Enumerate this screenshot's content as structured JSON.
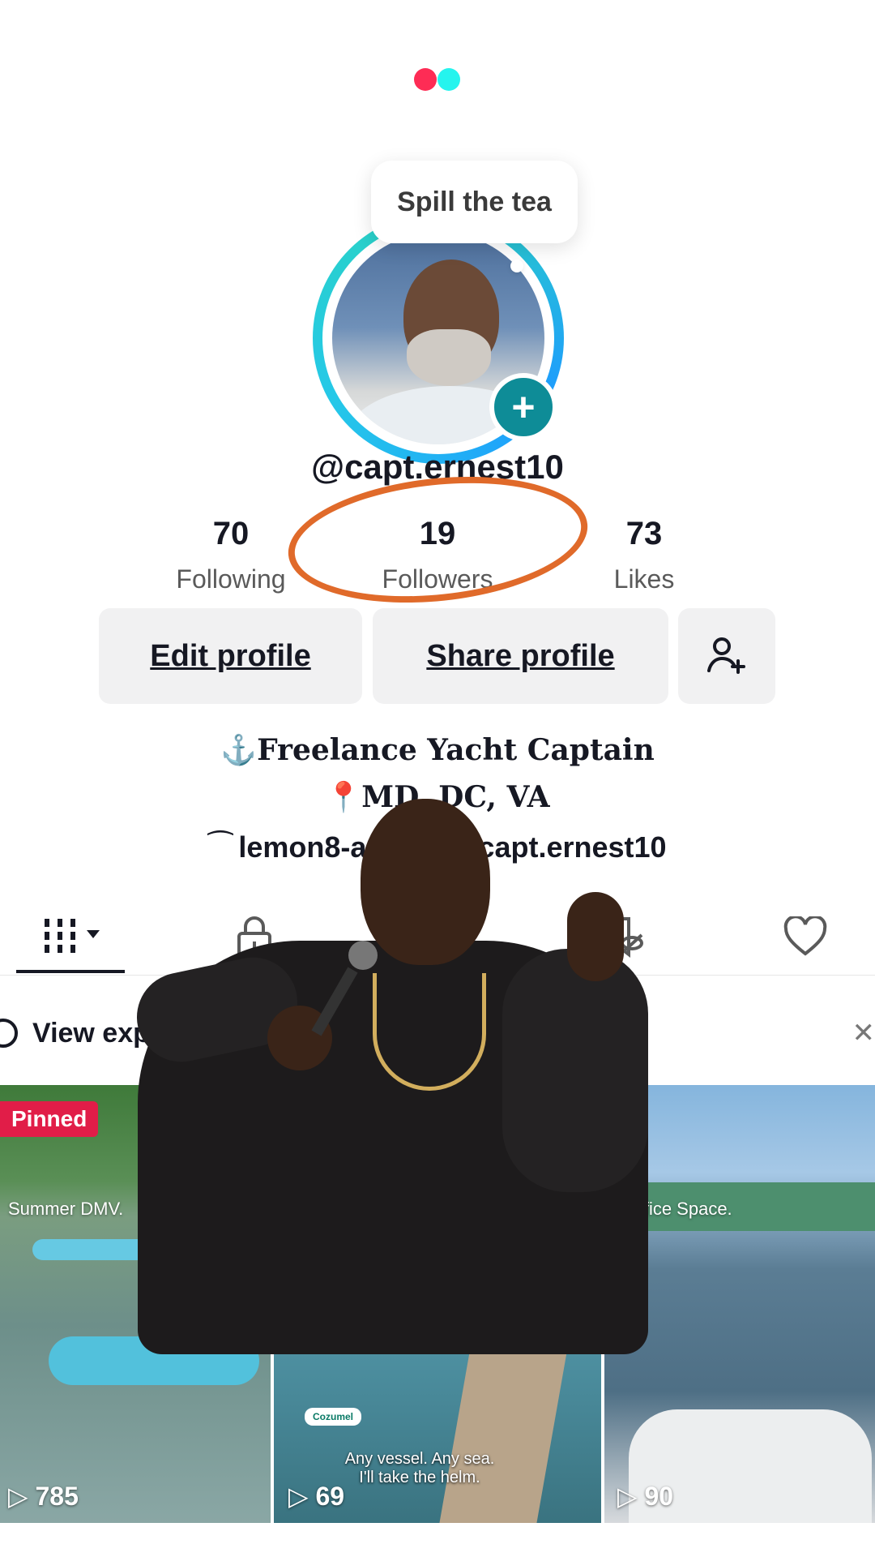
{
  "brand": {
    "dot_left_color": "#fe2c55",
    "dot_right_color": "#25f4ee"
  },
  "tooltip": {
    "text": "Spill the tea"
  },
  "profile": {
    "username": "@capt.ernest10",
    "stats": [
      {
        "value": "70",
        "label": "Following"
      },
      {
        "value": "19",
        "label": "Followers"
      },
      {
        "value": "73",
        "label": "Likes"
      }
    ],
    "buttons": {
      "edit": "Edit profile",
      "share": "Share profile"
    },
    "bio_line1": "⚓Freelance Yacht Captain",
    "bio_line2": "📍MD, DC, VA",
    "link": "lemon8-app.com/capt.ernest10"
  },
  "tabs": [
    "videos-grid",
    "private",
    "reposts-hidden",
    "liked"
  ],
  "banner": {
    "text": "View expired videos”"
  },
  "grid": [
    {
      "badge": "Pinned",
      "overlay": "Summer DMV.",
      "views": "785"
    },
    {
      "sticker": "Cozumel",
      "caption": "Any vessel. Any sea. I'll take the helm.",
      "views": "69"
    },
    {
      "overlay": "Office Space.",
      "views": "90"
    }
  ],
  "colors": {
    "accent": "#fe2c55",
    "teal": "#0e8c97",
    "annotation": "#e06a2a"
  }
}
